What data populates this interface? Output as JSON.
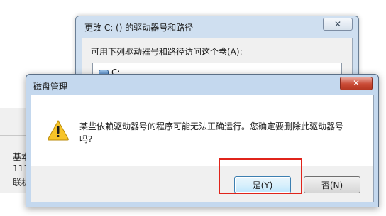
{
  "background": {
    "left_text": [
      "基本",
      "111",
      "联机"
    ]
  },
  "back_dialog": {
    "title": "更改 C: () 的驱动器号和路径",
    "close_label": "✕",
    "list_label": "可用下列驱动器号和路径访问这个卷(A):",
    "list_items": [
      "C:"
    ]
  },
  "modal": {
    "title": "磁盘管理",
    "close_label": "✕",
    "message": "某些依赖驱动器号的程序可能无法正确运行。您确定要删除此驱动器号吗?",
    "yes_label": "是(Y)",
    "no_label": "否(N)",
    "icon": "warning-icon"
  },
  "colors": {
    "highlight": "#e0241b",
    "close_button": "#c94a35",
    "title_bar": "#c4d8ee"
  }
}
